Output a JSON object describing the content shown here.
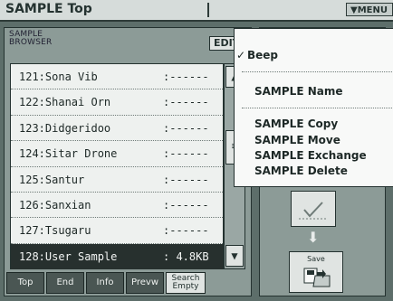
{
  "title": "SAMPLE Top",
  "menu_label": "▼MENU",
  "browser": {
    "label": "SAMPLE\nBROWSER",
    "edit_label": "EDIT",
    "items": [
      {
        "name": "121:Sona Vib",
        "size": ":------"
      },
      {
        "name": "122:Shanai Orn",
        "size": ":------"
      },
      {
        "name": "123:Didgeridoo",
        "size": ":------"
      },
      {
        "name": "124:Sitar Drone",
        "size": ":------"
      },
      {
        "name": "125:Santur",
        "size": ":------"
      },
      {
        "name": "126:Sanxian",
        "size": ":------"
      },
      {
        "name": "127:Tsugaru",
        "size": ":------"
      },
      {
        "name": "128:User Sample",
        "size": ": 4.8KB"
      }
    ],
    "selected_index": 7
  },
  "function_buttons": [
    "Top",
    "End",
    "Info",
    "Prevw",
    "Search\nEmpty"
  ],
  "save_label": "Save",
  "dropdown_menu": {
    "items": [
      {
        "label": "Beep",
        "checked": true
      },
      {
        "label": "SAMPLE Name",
        "checked": false
      },
      {
        "label": "SAMPLE Copy",
        "checked": false
      },
      {
        "label": "SAMPLE Move",
        "checked": false
      },
      {
        "label": "SAMPLE Exchange",
        "checked": false
      },
      {
        "label": "SAMPLE Delete",
        "checked": false
      }
    ],
    "check_glyph": "✓"
  },
  "icons": {
    "scroll_up": "scroll-up-arrow-icon",
    "scroll_down": "scroll-down-arrow-icon",
    "scroll_thumb": "scroll-thumb-grip-icon",
    "check": "check-icon",
    "arrow_down": "arrow-down-icon",
    "save": "save-disk-folder-icon"
  },
  "colors": {
    "background": "#5d6e6a",
    "panel": "#8c9b97",
    "list_bg": "#eef1ef",
    "selected_row": "#27302e",
    "menu_bg": "#f8f9f8"
  }
}
